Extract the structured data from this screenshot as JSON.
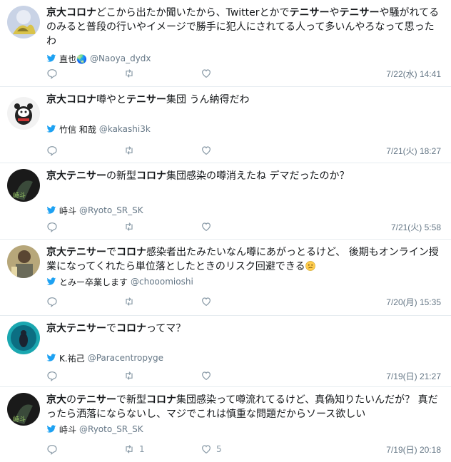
{
  "colors": {
    "keyword": "#14171a",
    "meta": "#657786",
    "icon": "#8899a6",
    "bird": "#1da1f2",
    "divider": "#e6ecf0"
  },
  "icons": {
    "reply": "reply-icon",
    "retweet": "retweet-icon",
    "like": "heart-icon",
    "source": "twitter-bird-icon"
  },
  "tweets": [
    {
      "segments": [
        {
          "t": "京大コロナ",
          "b": true
        },
        {
          "t": "どこから出たか聞いたから、Twitterとかで",
          "b": false
        },
        {
          "t": "テニサー",
          "b": true
        },
        {
          "t": "や",
          "b": false
        },
        {
          "t": "テニサー",
          "b": true
        },
        {
          "t": "や騒がれてるのみると普段の行いやイメージで勝手に犯人にされてる人って多いんやろなって思ったわ",
          "b": false
        }
      ],
      "name": "直也🌏",
      "handle": "@Naoya_dydx",
      "retweets": "",
      "likes": "",
      "date": "7/22(水) 14:41"
    },
    {
      "segments": [
        {
          "t": "京大コロナ",
          "b": true
        },
        {
          "t": "噂やと",
          "b": false
        },
        {
          "t": "テニサー",
          "b": true
        },
        {
          "t": "集団 うん納得だわ",
          "b": false
        }
      ],
      "name": "竹信 和哉",
      "handle": "@kakashi3k",
      "retweets": "",
      "likes": "",
      "date": "7/21(火) 18:27"
    },
    {
      "segments": [
        {
          "t": "京大テニサー",
          "b": true
        },
        {
          "t": "の新型",
          "b": false
        },
        {
          "t": "コロナ",
          "b": true
        },
        {
          "t": "集団感染の噂消えたね デマだったのか？",
          "b": false
        }
      ],
      "name": "峙斗",
      "handle": "@Ryoto_SR_SK",
      "retweets": "",
      "likes": "",
      "date": "7/21(火) 5:58"
    },
    {
      "segments": [
        {
          "t": "京大テニサー",
          "b": true
        },
        {
          "t": "で",
          "b": false
        },
        {
          "t": "コロナ",
          "b": true
        },
        {
          "t": "感染者出たみたいなん噂にあがっとるけど、 後期もオンライン授業になってくれたら単位落としたときのリスク回避できる",
          "b": false
        }
      ],
      "emoji": "confused-face",
      "name": "とみー卒業します",
      "handle": "@chooomioshi",
      "retweets": "",
      "likes": "",
      "date": "7/20(月) 15:35"
    },
    {
      "segments": [
        {
          "t": "京大テニサー",
          "b": true
        },
        {
          "t": "で",
          "b": false
        },
        {
          "t": "コロナ",
          "b": true
        },
        {
          "t": "ってマ？",
          "b": false
        }
      ],
      "name": "K.祐己",
      "handle": "@Paracentropyge",
      "retweets": "",
      "likes": "",
      "date": "7/19(日) 21:27"
    },
    {
      "segments": [
        {
          "t": "京大",
          "b": true
        },
        {
          "t": "の",
          "b": false
        },
        {
          "t": "テニサー",
          "b": true
        },
        {
          "t": "で新型",
          "b": false
        },
        {
          "t": "コロナ",
          "b": true
        },
        {
          "t": "集団感染って噂流れてるけど、真偽知りたいんだが？ 真だったら洒落にならないし、マジでこれは慎重な問題だからソース欲しい",
          "b": false
        }
      ],
      "name": "峙斗",
      "handle": "@Ryoto_SR_SK",
      "retweets": "1",
      "likes": "5",
      "date": "7/19(日) 20:18"
    }
  ]
}
